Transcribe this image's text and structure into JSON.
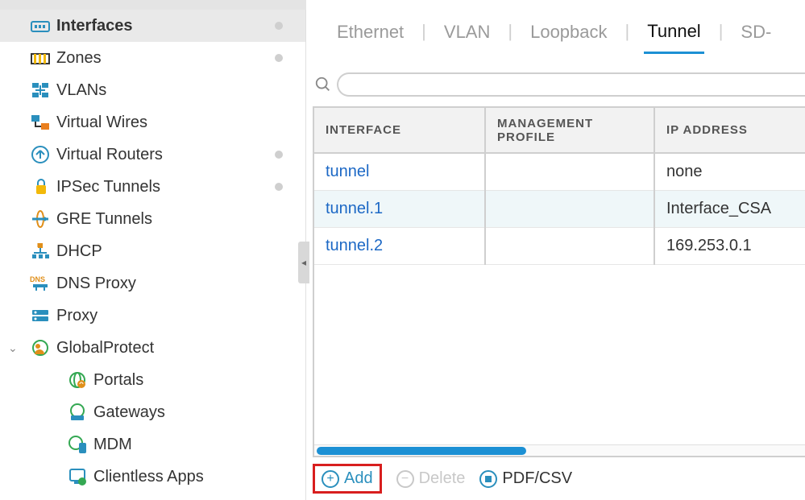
{
  "sidebar": {
    "items": [
      {
        "label": "Interfaces",
        "icon": "interfaces",
        "selected": true,
        "dot": true
      },
      {
        "label": "Zones",
        "icon": "zones",
        "dot": true
      },
      {
        "label": "VLANs",
        "icon": "vlans"
      },
      {
        "label": "Virtual Wires",
        "icon": "virtual-wires"
      },
      {
        "label": "Virtual Routers",
        "icon": "virtual-routers",
        "dot": true
      },
      {
        "label": "IPSec Tunnels",
        "icon": "ipsec",
        "dot": true
      },
      {
        "label": "GRE Tunnels",
        "icon": "gre"
      },
      {
        "label": "DHCP",
        "icon": "dhcp"
      },
      {
        "label": "DNS Proxy",
        "icon": "dnsproxy"
      },
      {
        "label": "Proxy",
        "icon": "proxy"
      },
      {
        "label": "GlobalProtect",
        "icon": "globalprotect",
        "expandable": true
      },
      {
        "label": "Portals",
        "icon": "portals",
        "indent": 1
      },
      {
        "label": "Gateways",
        "icon": "gateways",
        "indent": 1
      },
      {
        "label": "MDM",
        "icon": "mdm",
        "indent": 1
      },
      {
        "label": "Clientless Apps",
        "icon": "clientless",
        "indent": 1
      }
    ]
  },
  "tabs": [
    "Ethernet",
    "VLAN",
    "Loopback",
    "Tunnel",
    "SD-"
  ],
  "active_tab": "Tunnel",
  "search": {
    "value": ""
  },
  "table": {
    "columns": [
      "INTERFACE",
      "MANAGEMENT PROFILE",
      "IP ADDRESS"
    ],
    "rows": [
      {
        "interface": "tunnel",
        "profile": "",
        "ip": "none"
      },
      {
        "interface": "tunnel.1",
        "profile": "",
        "ip": "Interface_CSA"
      },
      {
        "interface": "tunnel.2",
        "profile": "",
        "ip": "169.253.0.1"
      }
    ]
  },
  "actions": {
    "add": "Add",
    "delete": "Delete",
    "pdf": "PDF/CSV"
  }
}
